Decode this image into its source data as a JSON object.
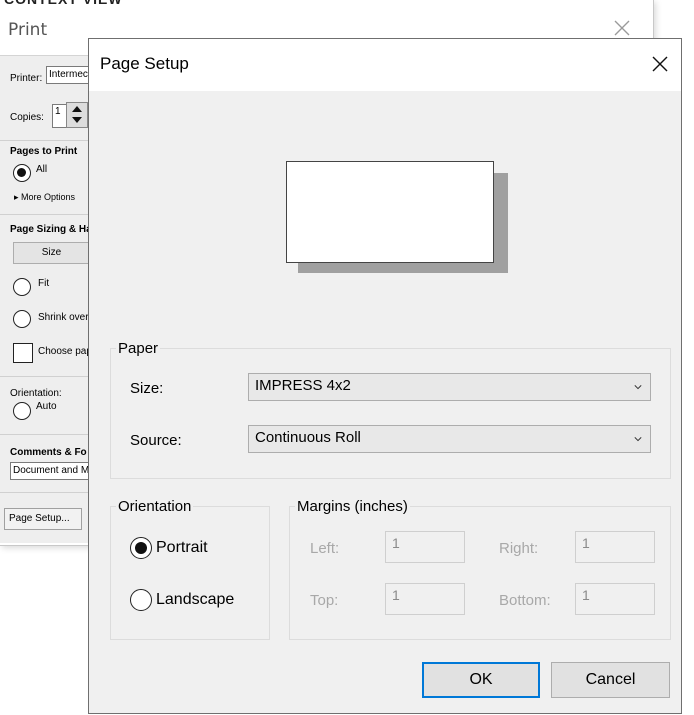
{
  "print": {
    "top_strip_text": "CONTEXT VIEW OPT",
    "title": "Print",
    "printer_label": "Printer:",
    "printer_value": "Intermec",
    "copies_label": "Copies:",
    "copies_value": "1",
    "pages_to_print_header": "Pages to Print",
    "all_label": "All",
    "more_options_label": "▸ More Options",
    "page_sizing_header": "Page Sizing & Ha",
    "size_button": "Size",
    "fit_label": "Fit",
    "shrink_label": "Shrink over",
    "choose_label": "Choose pap",
    "orientation_label": "Orientation:",
    "auto_label": "Auto",
    "comments_header": "Comments & Fo",
    "comments_value": "Document and M",
    "page_setup_button": "Page Setup..."
  },
  "page_setup": {
    "title": "Page Setup",
    "paper": {
      "group_label": "Paper",
      "size_label": "Size:",
      "size_value": "IMPRESS 4x2",
      "source_label": "Source:",
      "source_value": "Continuous Roll"
    },
    "orientation": {
      "group_label": "Orientation",
      "portrait_label": "Portrait",
      "landscape_label": "Landscape",
      "selected": "Portrait"
    },
    "margins": {
      "group_label": "Margins (inches)",
      "left_label": "Left:",
      "left_value": "1",
      "right_label": "Right:",
      "right_value": "1",
      "top_label": "Top:",
      "top_value": "1",
      "bottom_label": "Bottom:",
      "bottom_value": "1"
    },
    "ok_label": "OK",
    "cancel_label": "Cancel"
  },
  "icons": {
    "close": "close-icon",
    "dropdown": "chevron-down-icon"
  },
  "colors": {
    "dialog_bg": "#f0f0f0",
    "default_button_border": "#0078d7",
    "disabled_text": "#a8a8a8"
  }
}
